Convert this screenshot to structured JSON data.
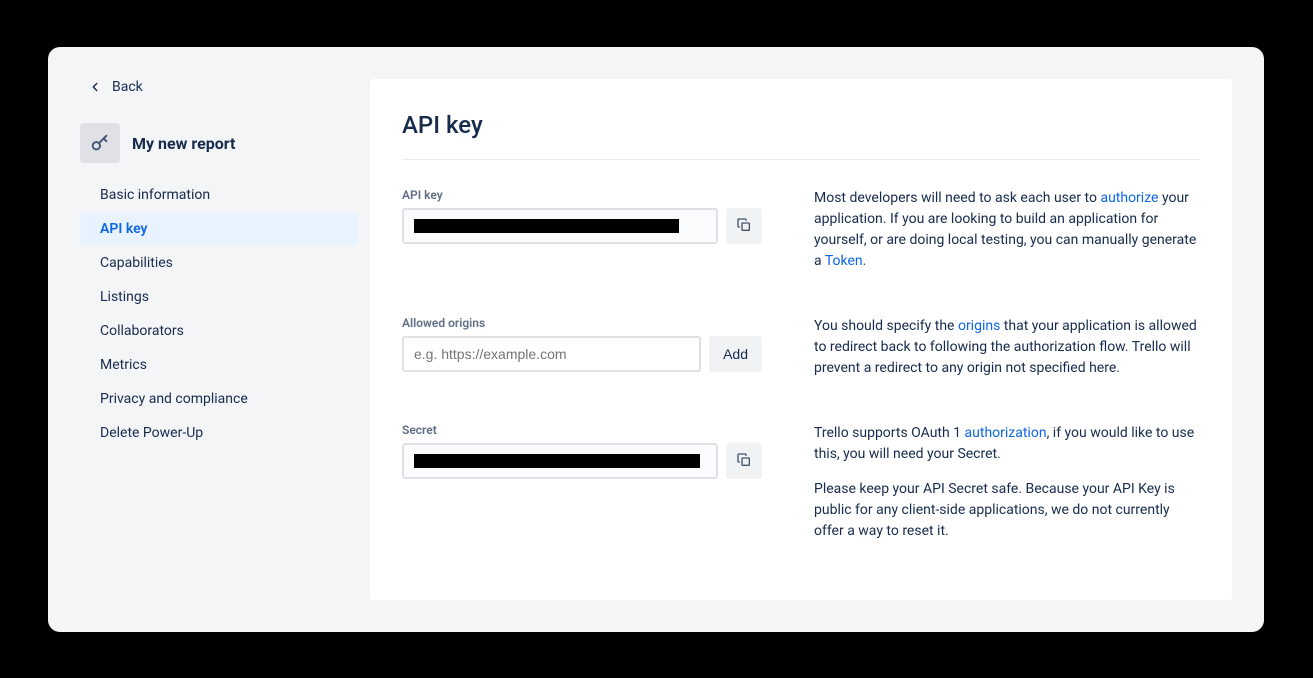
{
  "sidebar": {
    "back_label": "Back",
    "project_name": "My new report",
    "nav": [
      {
        "label": "Basic information",
        "active": false
      },
      {
        "label": "API key",
        "active": true
      },
      {
        "label": "Capabilities",
        "active": false
      },
      {
        "label": "Listings",
        "active": false
      },
      {
        "label": "Collaborators",
        "active": false
      },
      {
        "label": "Metrics",
        "active": false
      },
      {
        "label": "Privacy and compliance",
        "active": false
      },
      {
        "label": "Delete Power-Up",
        "active": false
      }
    ]
  },
  "page": {
    "title": "API key"
  },
  "apikey": {
    "label": "API key",
    "value": "████████████████████████████████",
    "help_pre": "Most developers will need to ask each user to ",
    "help_link": "authorize",
    "help_mid": " your application. If you are looking to build an application for yourself, or are doing local testing, you can manually generate a ",
    "help_link2": "Token",
    "help_post": "."
  },
  "origins": {
    "label": "Allowed origins",
    "placeholder": "e.g. https://example.com",
    "add_label": "Add",
    "help_pre": "You should specify the ",
    "help_link": "origins",
    "help_post": " that your application is allowed to redirect back to following the authorization flow. Trello will prevent a redirect to any origin not specified here."
  },
  "secret": {
    "label": "Secret",
    "value": "████████████████████████████████████████████████████████████████",
    "help1_pre": "Trello supports OAuth 1 ",
    "help1_link": "authorization",
    "help1_post": ", if you would like to use this, you will need your Secret.",
    "help2": "Please keep your API Secret safe. Because your API Key is public for any client-side applications, we do not currently offer a way to reset it."
  }
}
